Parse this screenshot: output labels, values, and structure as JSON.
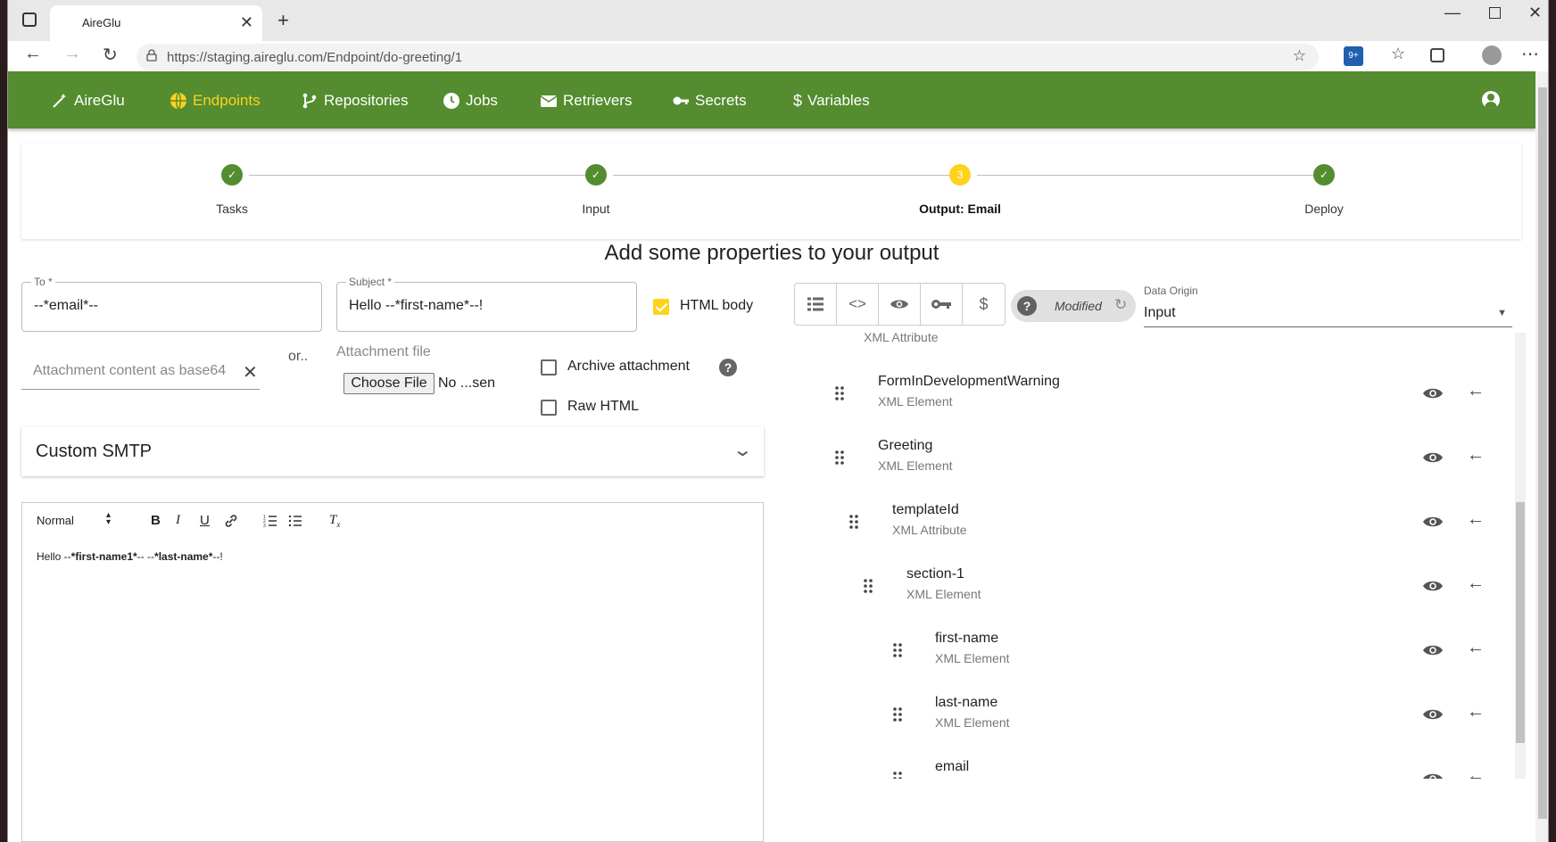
{
  "browser": {
    "tab_title": "AireGlu",
    "url": "https://staging.aireglu.com/Endpoint/do-greeting/1"
  },
  "appbar": {
    "brand": "AireGlu",
    "items": [
      {
        "label": "Endpoints",
        "icon": "globe-icon",
        "active": true
      },
      {
        "label": "Repositories",
        "icon": "branch-icon"
      },
      {
        "label": "Jobs",
        "icon": "clock-icon"
      },
      {
        "label": "Retrievers",
        "icon": "envelope-icon"
      },
      {
        "label": "Secrets",
        "icon": "key-icon"
      },
      {
        "label": "Variables",
        "icon": "dollar-icon"
      }
    ],
    "accent": "#548c2f",
    "active_color": "#ffd21e"
  },
  "stepper": {
    "steps": [
      {
        "label": "Tasks",
        "status": "done"
      },
      {
        "label": "Input",
        "status": "done"
      },
      {
        "label": "Output: Email",
        "status": "current",
        "number": "3"
      },
      {
        "label": "Deploy",
        "status": "done"
      }
    ]
  },
  "heading": "Add some properties to your output",
  "form": {
    "to_label": "To *",
    "to_value": "--*email*--",
    "subject_label": "Subject *",
    "subject_value": "Hello --*first-name*--!",
    "html_body_label": "HTML body",
    "html_body_checked": true,
    "attachment_placeholder": "Attachment content as base64",
    "or_text": "or..",
    "attachment_file_label": "Attachment file",
    "choose_file_label": "Choose File",
    "no_file_text": "No ...sen",
    "archive_label": "Archive attachment",
    "raw_html_label": "Raw HTML",
    "custom_smtp_label": "Custom SMTP"
  },
  "editor": {
    "format_select": "Normal",
    "content_parts": [
      "Hello --",
      "*first-name1*",
      "-- --",
      "*last-name*",
      "--!"
    ]
  },
  "right_panel": {
    "chip_label": "Modified",
    "data_origin_label": "Data Origin",
    "data_origin_value": "Input",
    "partial_top_type": "XML Attribute",
    "tree": [
      {
        "name": "FormInDevelopmentWarning",
        "type": "XML Element",
        "level": 0
      },
      {
        "name": "Greeting",
        "type": "XML Element",
        "level": 0
      },
      {
        "name": "templateId",
        "type": "XML Attribute",
        "level": 1
      },
      {
        "name": "section-1",
        "type": "XML Element",
        "level": 2
      },
      {
        "name": "first-name",
        "type": "XML Element",
        "level": 4
      },
      {
        "name": "last-name",
        "type": "XML Element",
        "level": 4
      },
      {
        "name": "email",
        "type": "",
        "level": 4
      }
    ]
  }
}
